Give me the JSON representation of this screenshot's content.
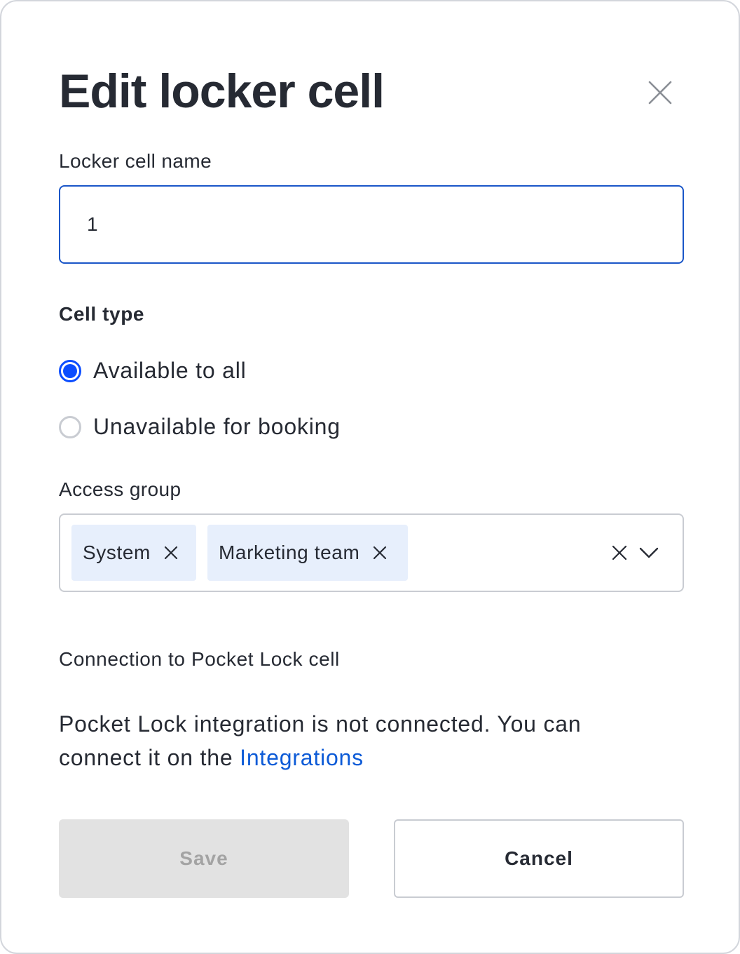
{
  "modal": {
    "title": "Edit locker cell"
  },
  "name_field": {
    "label": "Locker cell name",
    "value": "1"
  },
  "cell_type": {
    "title": "Cell type",
    "options": [
      {
        "label": "Available to all",
        "checked": true
      },
      {
        "label": "Unavailable for booking",
        "checked": false
      }
    ]
  },
  "access_group": {
    "label": "Access group",
    "chips": [
      {
        "label": "System"
      },
      {
        "label": "Marketing team"
      }
    ]
  },
  "connection": {
    "label": "Connection to Pocket Lock cell",
    "text": "Pocket Lock integration is not connected. You can connect it on the ",
    "link": "Integrations"
  },
  "actions": {
    "save_label": "Save",
    "cancel_label": "Cancel"
  },
  "colors": {
    "accent": "#0b4dff",
    "link": "#0d5bd7",
    "input_focus_border": "#1a56c8",
    "chip_bg": "#e7effc",
    "disabled_bg": "#e2e2e2",
    "disabled_text": "#a3a3a3"
  },
  "icons": {
    "close": "close-icon",
    "chip_remove": "x-icon",
    "clear": "clear-icon",
    "dropdown": "chevron-down-icon"
  }
}
